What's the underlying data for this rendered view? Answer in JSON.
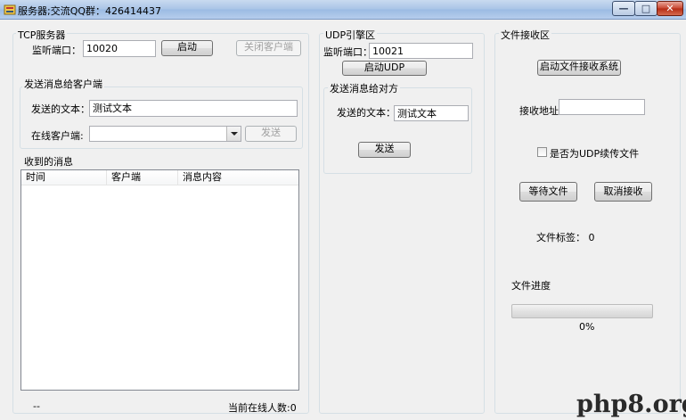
{
  "window": {
    "title": "服务器;交流QQ群：426414437",
    "min_glyph": "—",
    "max_glyph": "□",
    "close_glyph": "✕"
  },
  "tcp": {
    "group_title": "TCP服务器",
    "listen_port_label": "监听端口：",
    "listen_port_value": "10020",
    "start_button": "启动",
    "close_client_button": "关闭客户端",
    "send_group_title": "发送消息给客户端",
    "send_text_label": "发送的文本：",
    "send_text_value": "测试文本",
    "online_client_label": "在线客户端:",
    "online_client_value": "",
    "send_button": "发送",
    "received_group_title": "收到的消息",
    "columns": [
      "时间",
      "客户端",
      "消息内容"
    ],
    "footer_left": "--",
    "online_count_text": "当前在线人数:0"
  },
  "udp": {
    "group_title": "UDP引擎区",
    "listen_port_label": "监听端口：",
    "listen_port_value": "10021",
    "start_button": "启动UDP",
    "send_group_title": "发送消息给对方",
    "send_text_label": "发送的文本：",
    "send_text_value": "测试文本",
    "send_button": "发送"
  },
  "file": {
    "group_title": "文件接收区",
    "start_button": "启动文件接收系统",
    "recv_addr_label": "接收地址",
    "recv_addr_value": "",
    "udp_resume_label": "是否为UDP续传文件",
    "udp_resume_checked": false,
    "wait_button": "等待文件",
    "cancel_button": "取消接收",
    "tag_text": "文件标签：  0",
    "progress_label": "文件进度",
    "progress_percent": 0,
    "progress_text": "0%"
  },
  "watermark": "php8.org"
}
